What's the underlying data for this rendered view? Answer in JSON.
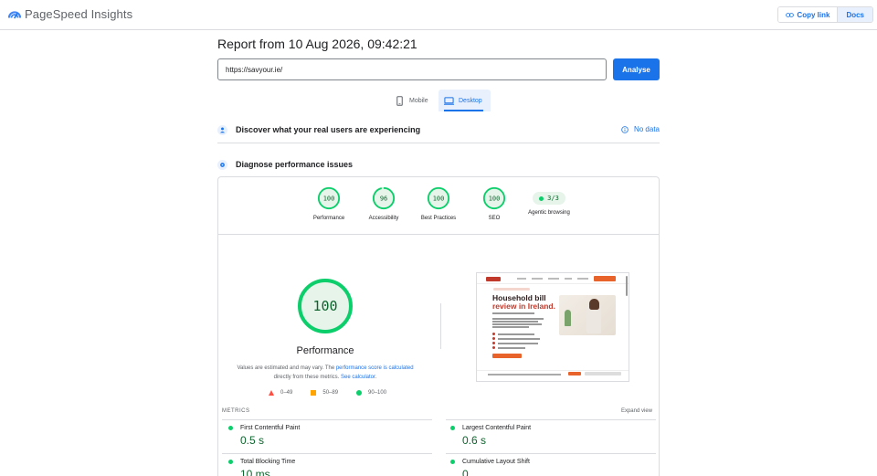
{
  "app": {
    "brand": "PageSpeed Insights",
    "copy_link": "Copy link",
    "docs": "Docs"
  },
  "report": {
    "title": "Report from 10 Aug 2026, 09:42:21",
    "url_value": "https://savyour.ie/",
    "analyse": "Analyse"
  },
  "tabs": {
    "mobile": "Mobile",
    "desktop": "Desktop",
    "active": "desktop"
  },
  "crux": {
    "title": "Discover what your real users are experiencing",
    "status": "No data"
  },
  "diagnose": {
    "title": "Diagnose performance issues"
  },
  "categories": [
    {
      "label": "Performance",
      "score": "100"
    },
    {
      "label": "Accessibility",
      "score": "96"
    },
    {
      "label": "Best Practices",
      "score": "100"
    },
    {
      "label": "SEO",
      "score": "100"
    }
  ],
  "agentic": {
    "label": "Agentic browsing",
    "value": "3/3"
  },
  "performance": {
    "score": "100",
    "title": "Performance",
    "desc_part1": "Values are estimated and may vary. The ",
    "desc_link1": "performance score is calculated",
    "desc_part2": " directly from these metrics. ",
    "desc_link2": "See calculator."
  },
  "legend": {
    "fail": "0–49",
    "average": "50–89",
    "pass": "90–100"
  },
  "screenshot": {
    "headline_line1": "Household bill",
    "headline_line2": "review in Ireland."
  },
  "metrics": {
    "label": "METRICS",
    "expand": "Expand view",
    "items": [
      {
        "name": "First Contentful Paint",
        "value": "0.5 s"
      },
      {
        "name": "Largest Contentful Paint",
        "value": "0.6 s"
      },
      {
        "name": "Total Blocking Time",
        "value": "10 ms"
      },
      {
        "name": "Cumulative Layout Shift",
        "value": "0"
      }
    ]
  },
  "colors": {
    "accent": "#1a73e8",
    "pass": "#0cce6b",
    "pass_text": "#0d652d",
    "pass_bg": "#e6f4ea",
    "average": "#ffa400",
    "fail": "#ff4e42"
  }
}
